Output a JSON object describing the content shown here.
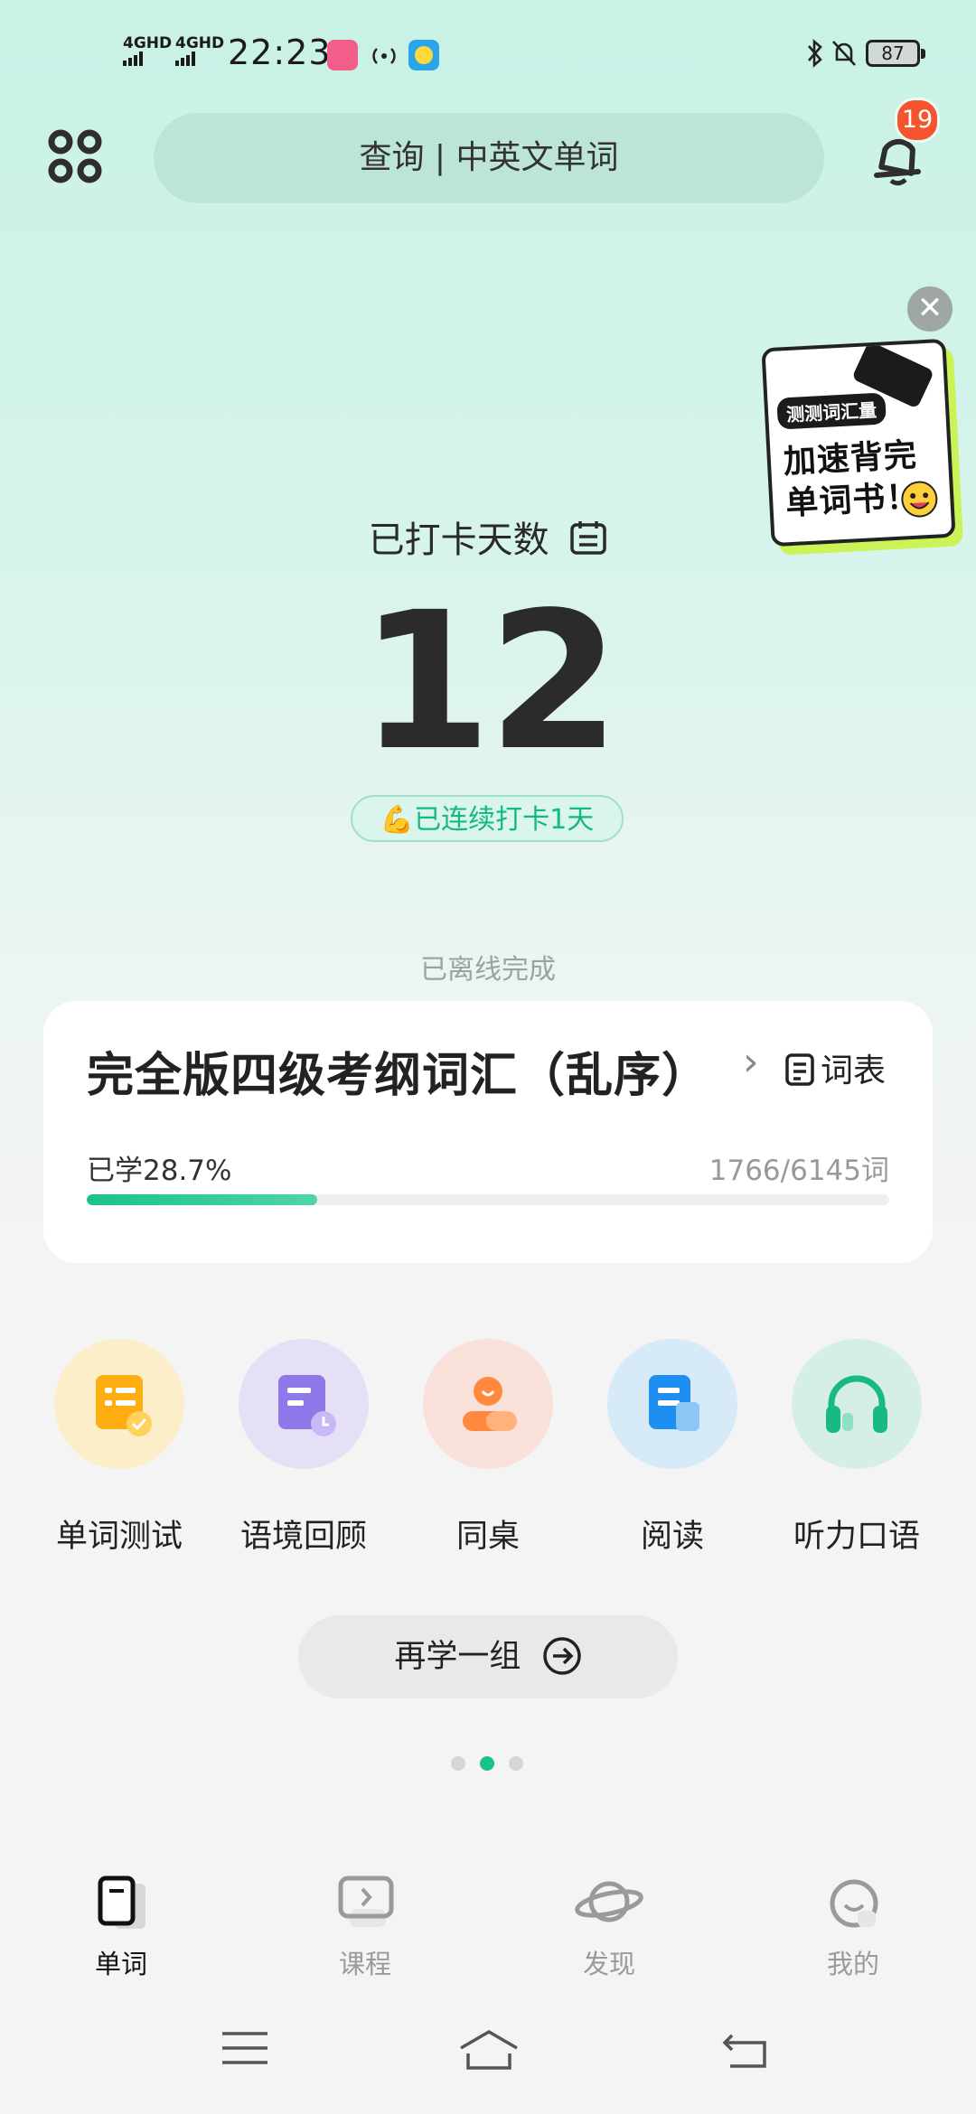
{
  "status_bar": {
    "signal1": "4GHD",
    "signal2": "4GHD",
    "time": "22:23",
    "battery": "87"
  },
  "header": {
    "search_text": "查询 | 中英文单词",
    "notification_count": "19"
  },
  "promo": {
    "tag": "测测词汇量",
    "line1": "加速背完",
    "line2": "单词书！",
    "close": "✕"
  },
  "checkin": {
    "label": "已打卡天数",
    "days": "12",
    "streak": "💪已连续打卡1天"
  },
  "offline_text": "已离线完成",
  "book": {
    "title": "完全版四级考纲词汇（乱序）",
    "wordlist_label": "词表",
    "learned_label": "已学28.7%",
    "count": "1766/6145词",
    "progress": 0.287
  },
  "tools": [
    {
      "label": "单词测试",
      "icon": "word-test-icon",
      "bg": "#fbeec8"
    },
    {
      "label": "语境回顾",
      "icon": "context-review-icon",
      "bg": "#e6e0f7"
    },
    {
      "label": "同桌",
      "icon": "deskmate-icon",
      "bg": "#f9e1da"
    },
    {
      "label": "阅读",
      "icon": "reading-icon",
      "bg": "#d7eaf7"
    },
    {
      "label": "听力口语",
      "icon": "headphones-icon",
      "bg": "#d6efe6"
    }
  ],
  "study_again_label": "再学一组",
  "pager": {
    "count": 3,
    "active": 1
  },
  "bottom_nav": [
    {
      "label": "单词",
      "icon": "word-book-icon",
      "active": true
    },
    {
      "label": "课程",
      "icon": "course-play-icon",
      "active": false
    },
    {
      "label": "发现",
      "icon": "planet-icon",
      "active": false
    },
    {
      "label": "我的",
      "icon": "smile-profile-icon",
      "active": false
    }
  ],
  "colors": {
    "accent": "#19c38a",
    "badge": "#f4552f"
  }
}
